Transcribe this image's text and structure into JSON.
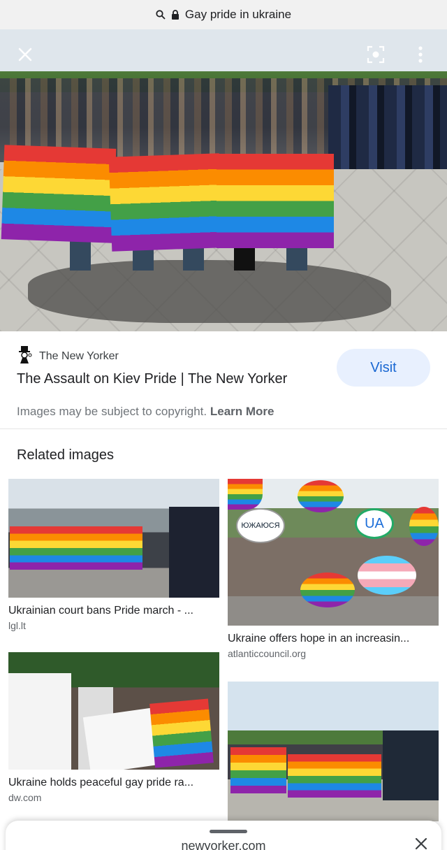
{
  "url_bar": {
    "query": "Gay pride in ukraine"
  },
  "result": {
    "source_name": "The New Yorker",
    "title": "The Assault on Kiev Pride | The New Yorker",
    "visit_label": "Visit",
    "copyright_text": "Images may be subject to copyright.",
    "learn_more_label": "Learn More"
  },
  "related": {
    "heading": "Related images",
    "items": [
      {
        "caption": "Ukrainian court bans Pride march - ...",
        "domain": "lgl.lt"
      },
      {
        "caption": "Ukraine offers hope in an increasin...",
        "domain": "atlanticcouncil.org",
        "sign_text_1": "ЮЖАЮСЯ",
        "sign_text_2": "UA"
      },
      {
        "caption": "Ukraine holds peaceful gay pride ra...",
        "domain": "dw.com"
      },
      {
        "caption": "",
        "domain": ""
      }
    ]
  },
  "bottom_sheet": {
    "host": "newyorker.com"
  },
  "icons": {
    "search": "search-icon",
    "lock": "lock-icon",
    "close": "close-icon",
    "lens": "lens-icon",
    "more": "more-vert-icon",
    "source_logo": "new-yorker-logo-icon"
  },
  "colors": {
    "accent": "#1967d2",
    "visit_bg": "#e8f0fe",
    "muted": "#70757a"
  }
}
